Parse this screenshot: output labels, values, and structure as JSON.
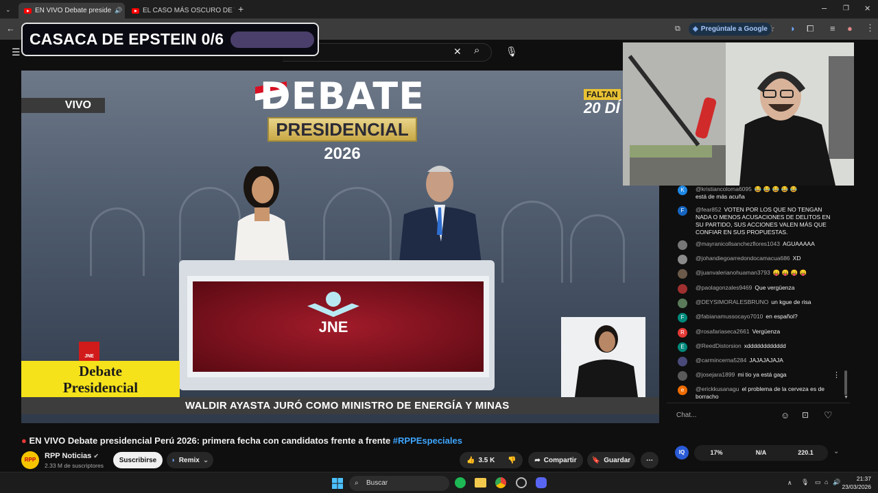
{
  "browser": {
    "tabs": [
      {
        "label": "EN VIVO Debate preside"
      },
      {
        "label": "EL CASO MÁS OSCURO DE TW"
      }
    ],
    "ask_google": "Pregúntale a Google"
  },
  "overlay": {
    "title": "CASACA DE EPSTEIN 0/6"
  },
  "player": {
    "vivo": "VIVO",
    "logo_debate": "DEBATE",
    "logo_presidencial": "PRESIDENCIAL",
    "logo_year": "2026",
    "faltan": "FALTAN",
    "faltan_days": "20 DÍ",
    "jne": "JNE",
    "lower_third_line1": "Debate",
    "lower_third_line2": "Presidencial",
    "rpp_mini": "JNE",
    "ticker": "WALDIR AYASTA JURÓ COMO MINISTRO DE ENERGÍA Y MINAS"
  },
  "chat": {
    "messages": [
      {
        "initial": "K",
        "color": "#1e88e5",
        "author": "@kristiancoloma6095",
        "text": "😂 😂 😂 😂 😂",
        "text2": "está de más acuña"
      },
      {
        "initial": "F",
        "color": "#1565c0",
        "author": "@fear852",
        "text": "VOTEN POR LOS QUE NO TENGAN NADA O MENOS ACUSACIONES DE DELITOS EN SU PARTIDO, SUS ACCIONES VALEN MÁS QUE CONFIAR EN SUS PROPUESTAS."
      },
      {
        "initial": "",
        "color": "#777777",
        "author": "@mayranicollsanchezflores1043",
        "text": "AGUAAAAA"
      },
      {
        "initial": "",
        "color": "#8a8a8a",
        "author": "@johandiegoarredondocamacua686",
        "text": "XD"
      },
      {
        "initial": "",
        "color": "#6b5a4a",
        "author": "@juanvalerianohuaman3793",
        "text": "😛 😛 😛 😛"
      },
      {
        "initial": "",
        "color": "#a03030",
        "author": "@paolagonzales9469",
        "text": "Que vergüenza"
      },
      {
        "initial": "",
        "color": "#5a7a5a",
        "author": "@DEYSIMORALESBRUNO",
        "text": "un kgue de risa"
      },
      {
        "initial": "F",
        "color": "#00897b",
        "author": "@fabianamussocayo7010",
        "text": "en español?"
      },
      {
        "initial": "R",
        "color": "#e53935",
        "author": "@rosafariaseca2661",
        "text": "Vergüenza"
      },
      {
        "initial": "E",
        "color": "#00897b",
        "author": "@ReedDistorsion",
        "text": "xdddddddddddd"
      },
      {
        "initial": "",
        "color": "#4a4a7a",
        "author": "@carmincerna5284",
        "text": "JAJAJAJAJA"
      },
      {
        "initial": "",
        "color": "#5a5a5a",
        "author": "@josejara1899",
        "text": "mi tio ya está gaga"
      },
      {
        "initial": "e",
        "color": "#ef6c00",
        "author": "@erickkusanagu",
        "text": "el problema de la cerveza es de",
        "text2": "borracho"
      }
    ],
    "input_placeholder": "Chat..."
  },
  "video": {
    "title": "EN VIVO Debate presidencial Perú 2026: primera fecha con candidatos frente a frente",
    "hashtag": "#RPPEspeciales",
    "channel": "RPP Noticias",
    "channel_logo": "RPP",
    "subscribers": "2.33 M de suscriptores",
    "subscribe": "Suscribirse",
    "remix": "Remix",
    "likes": "3.5 K",
    "share": "Compartir",
    "save": "Guardar"
  },
  "stats": {
    "badge": "IQ",
    "a": "17%",
    "b": "N/A",
    "c": "220.1"
  },
  "taskbar": {
    "search": "Buscar",
    "time": "21:37",
    "date": "23/03/2026"
  }
}
